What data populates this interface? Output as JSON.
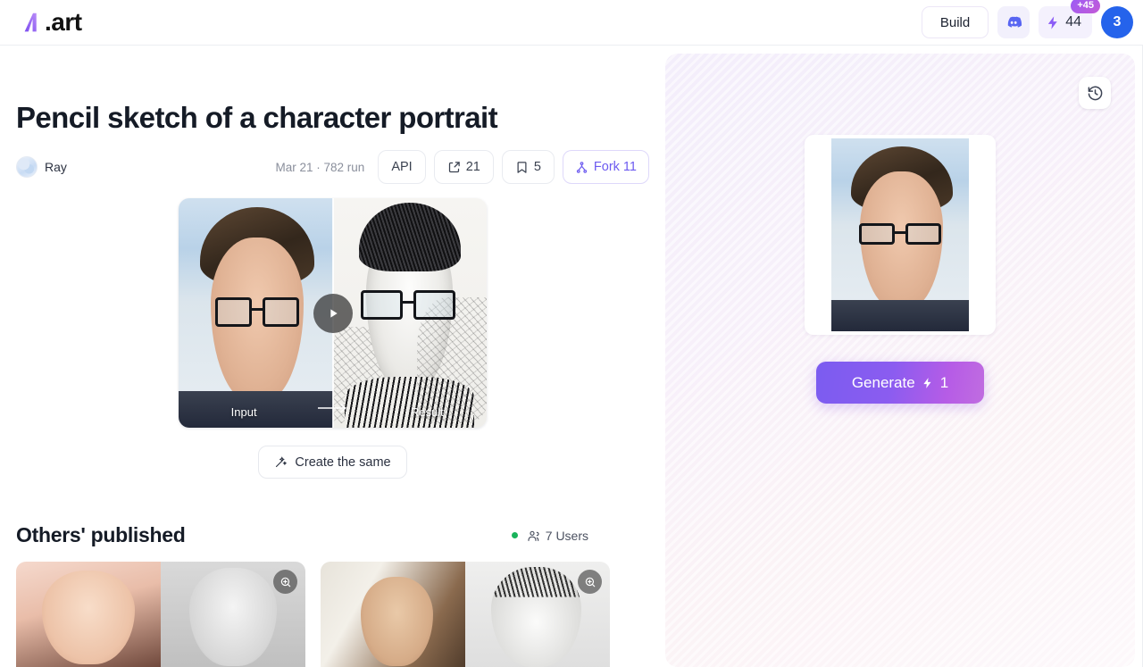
{
  "topbar": {
    "logo_text": ".art",
    "build_label": "Build",
    "discord_icon": "discord-icon",
    "credits": {
      "icon": "lightning-icon",
      "value": "44",
      "badge": "+45"
    },
    "avatar": {
      "initial": "3",
      "color": "#2563eb"
    }
  },
  "page": {
    "title": "Pencil sketch of a character portrait",
    "author": "Ray",
    "date_runs": "Mar 21 · 782 run",
    "actions": [
      {
        "name": "api",
        "label": "API",
        "icon": null
      },
      {
        "name": "share",
        "label": "21",
        "icon": "share-icon"
      },
      {
        "name": "bookmark",
        "label": "5",
        "icon": "bookmark-icon"
      },
      {
        "name": "fork",
        "label": "Fork 11",
        "icon": "fork-icon"
      }
    ]
  },
  "media": {
    "input_label": "Input",
    "result_label": "Result",
    "play_icon": "play-icon",
    "create_same_label": "Create the same",
    "create_same_icon": "magic-wand-icon"
  },
  "others": {
    "heading": "Others' published",
    "users_count": "7 Users",
    "users_icon": "users-icon",
    "status_dot_color": "#19b35b",
    "cards": [
      {
        "name": "published-card-1",
        "zoom_icon": "zoom-in-icon"
      },
      {
        "name": "published-card-2",
        "zoom_icon": "zoom-in-icon"
      }
    ]
  },
  "generate_panel": {
    "history_icon": "history-clock-icon",
    "generate_label": "Generate",
    "generate_cost": "1",
    "generate_cost_icon": "lightning-icon",
    "accent_gradient_from": "#7b5cf0",
    "accent_gradient_to": "#c06de0"
  }
}
